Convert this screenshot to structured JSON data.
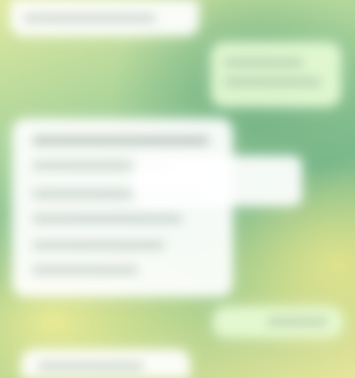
{
  "chat": {
    "messages": [
      {
        "id": "m1",
        "direction": "incoming"
      },
      {
        "id": "m2",
        "direction": "outgoing"
      },
      {
        "id": "m3",
        "direction": "incoming"
      },
      {
        "id": "m4",
        "direction": "outgoing"
      },
      {
        "id": "m5",
        "direction": "incoming"
      }
    ]
  },
  "colors": {
    "background_green": "#7dba8c",
    "background_yellow": "#e6e59a",
    "incoming_bubble": "#ffffff",
    "outgoing_bubble": "#e8fcd6"
  }
}
